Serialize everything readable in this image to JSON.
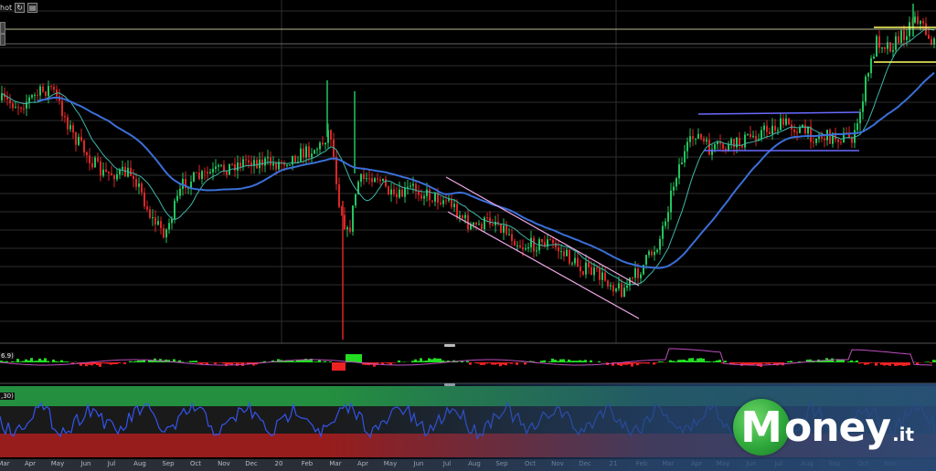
{
  "toolbar": {
    "label": "hot",
    "refresh_icon": "refresh-icon",
    "image_icon": "image-icon"
  },
  "indicators": {
    "macd_label": "6.9)",
    "rsi_label": ",30)"
  },
  "brand": {
    "initial": "M",
    "name": "oney",
    "tld": ".it"
  },
  "colors": {
    "background": "#000000",
    "up_candle": "#22c55e",
    "down_candle": "#dc2626",
    "sma_fast": "#3fb6a8",
    "sma_slow": "#3b6fd8",
    "channel_lines": "#f0a8e8",
    "range_lines": "#6a6aff",
    "breakout_lines": "#ffff66",
    "macd_positive": "#22dd22",
    "macd_negative": "#ee2222",
    "rsi_line": "#3355ee",
    "rsi_upper_zone": "#2aa84a",
    "rsi_lower_zone": "#b22222"
  },
  "chart_data": {
    "type": "candlestick",
    "x_ticks": [
      "Mar",
      "Apr",
      "May",
      "Jun",
      "Jul",
      "Aug",
      "Sep",
      "Oct",
      "Nov",
      "Dec",
      "20",
      "Feb",
      "Mar",
      "Apr",
      "May",
      "Jun",
      "Jul",
      "Aug",
      "Sep",
      "Oct",
      "Nov",
      "Dec",
      "21",
      "Feb",
      "Mar",
      "Apr",
      "May",
      "Jun",
      "Jul",
      "Aug",
      "Sep",
      "Oct",
      "Nov"
    ],
    "grid": true,
    "overlays": [
      "moving average (fast)",
      "moving average (slow)",
      "descending channel",
      "horizontal range",
      "breakout range"
    ],
    "sub_panels": [
      "MACD histogram",
      "RSI"
    ]
  }
}
